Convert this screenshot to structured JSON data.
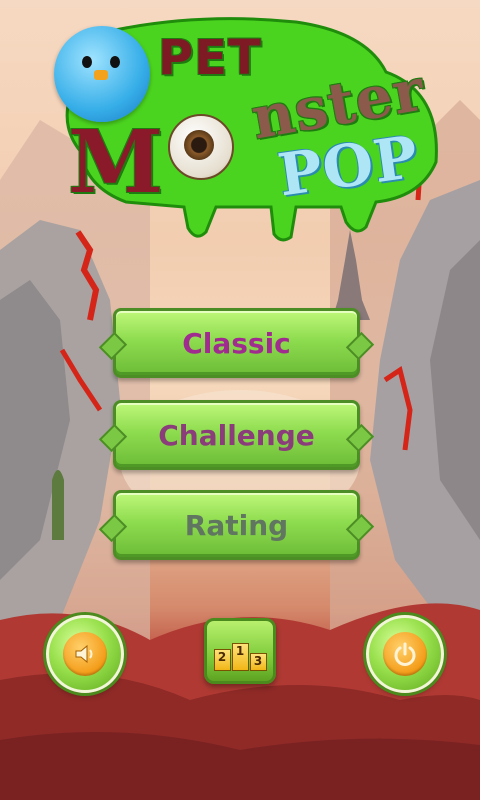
{
  "logo": {
    "word1": "PET",
    "word2_initial": "M",
    "word2_rest": "nster",
    "word3": "POP"
  },
  "menu": {
    "classic": "Classic",
    "challenge": "Challenge",
    "rating": "Rating"
  },
  "bottom_bar": {
    "sound_icon": "speaker-icon",
    "rank_icon": "podium-icon",
    "power_icon": "power-icon",
    "podium_places": [
      "2",
      "1",
      "3"
    ]
  },
  "colors": {
    "button_green": "#8edc4f",
    "classic_text": "#a12c8f",
    "challenge_text": "#8b3d7b",
    "rating_text": "#607660",
    "badge_orange": "#f39b17"
  }
}
